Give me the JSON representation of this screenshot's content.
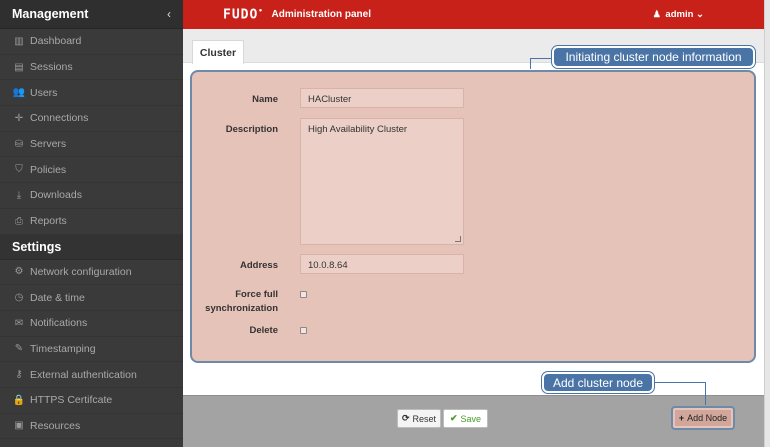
{
  "sidebar": {
    "header": "Management",
    "collapse_icon": "‹",
    "management_items": [
      {
        "label": "Dashboard",
        "icon": "▥"
      },
      {
        "label": "Sessions",
        "icon": "▤"
      },
      {
        "label": "Users",
        "icon": "👥"
      },
      {
        "label": "Connections",
        "icon": "✛"
      },
      {
        "label": "Servers",
        "icon": "⛁"
      },
      {
        "label": "Policies",
        "icon": "⛉"
      },
      {
        "label": "Downloads",
        "icon": "⤓"
      },
      {
        "label": "Reports",
        "icon": "⎙"
      }
    ],
    "settings_header": "Settings",
    "settings_items": [
      {
        "label": "Network configuration",
        "icon": "⚙"
      },
      {
        "label": "Date & time",
        "icon": "◷"
      },
      {
        "label": "Notifications",
        "icon": "✉"
      },
      {
        "label": "Timestamping",
        "icon": "✎"
      },
      {
        "label": "External authentication",
        "icon": "⚷"
      },
      {
        "label": "HTTPS Certifcate",
        "icon": "🔒"
      },
      {
        "label": "Resources",
        "icon": "▣"
      }
    ]
  },
  "topbar": {
    "logo": "FUDO",
    "logo_mark": "•",
    "title": "Administration panel",
    "user": "admin",
    "user_icon": "♟",
    "user_caret": "⌄",
    "color": "#c8211a"
  },
  "tab": {
    "label": "Cluster"
  },
  "form": {
    "name_label": "Name",
    "name_value": "HACluster",
    "description_label": "Description",
    "description_value": "High Availability Cluster",
    "address_label": "Address",
    "address_value": "10.0.8.64",
    "force_sync_label_line1": "Force full",
    "force_sync_label_line2": "synchronization",
    "delete_label": "Delete",
    "highlight_color": "#e6c3b8"
  },
  "callouts": {
    "top": "Initiating cluster node information",
    "bottom": "Add cluster node",
    "color": "#4a74a6"
  },
  "actions": {
    "reset_label": "Reset",
    "reset_icon": "⟳",
    "save_label": "Save",
    "save_icon": "✔",
    "add_node_label": "Add Node",
    "add_node_icon": "+"
  }
}
